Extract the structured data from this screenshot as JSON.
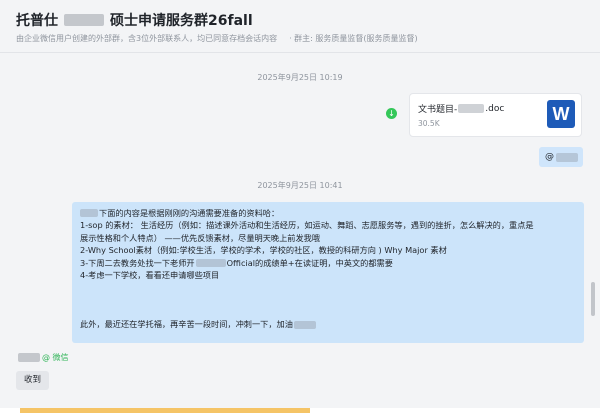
{
  "header": {
    "title_prefix": "托普仕",
    "title_suffix": "硕士申请服务群26fall",
    "subtitle_left": "由企业微信用户创建的外部群，含3位外部联系人，均已同意存档会话内容",
    "subtitle_right": "· 群主: 服务质量监督(服务质量监督)"
  },
  "timestamps": [
    "2025年9月25日 10:19",
    "2025年9月25日 10:41"
  ],
  "file_message": {
    "name_prefix": "文书题目-",
    "name_suffix": ".doc",
    "size": "30.5K",
    "icon_letter": "W",
    "icon_color": "#1e5bb8"
  },
  "mention": {
    "text": "@"
  },
  "message": {
    "line1": "下面的内容是根据刚刚的沟通需要准备的资料哈：",
    "line2": "1-sop 的素材： 生活经历（例如：描述课外活动和生活经历，如运动、舞蹈、志愿服务等，遇到的挫折，怎么解决的，重点是",
    "line3": "展示性格和个人特点） ——优先反馈素材，尽量明天晚上前发我哦",
    "line4": "2-Why School素材（例如:学校生活，学校的学术，学校的社区，教授的科研方向 ) Why Major 素材",
    "line5a": "3-下周二去教务处找一下老师开",
    "line5b": "Official的成绩单+在读证明，中英文的都需要",
    "line6": "4-考虑一下学校，看看还申请哪些项目",
    "line7": "此外，最近还在学托福，再辛苦一段时间，冲刺一下，加油"
  },
  "sender": {
    "platform_tag": "@ 微信"
  },
  "actions": {
    "received_label": "收到"
  },
  "colors": {
    "bubble_bg": "#cce4fa",
    "status_green": "#34c759",
    "wechat_green": "#2fb457"
  }
}
